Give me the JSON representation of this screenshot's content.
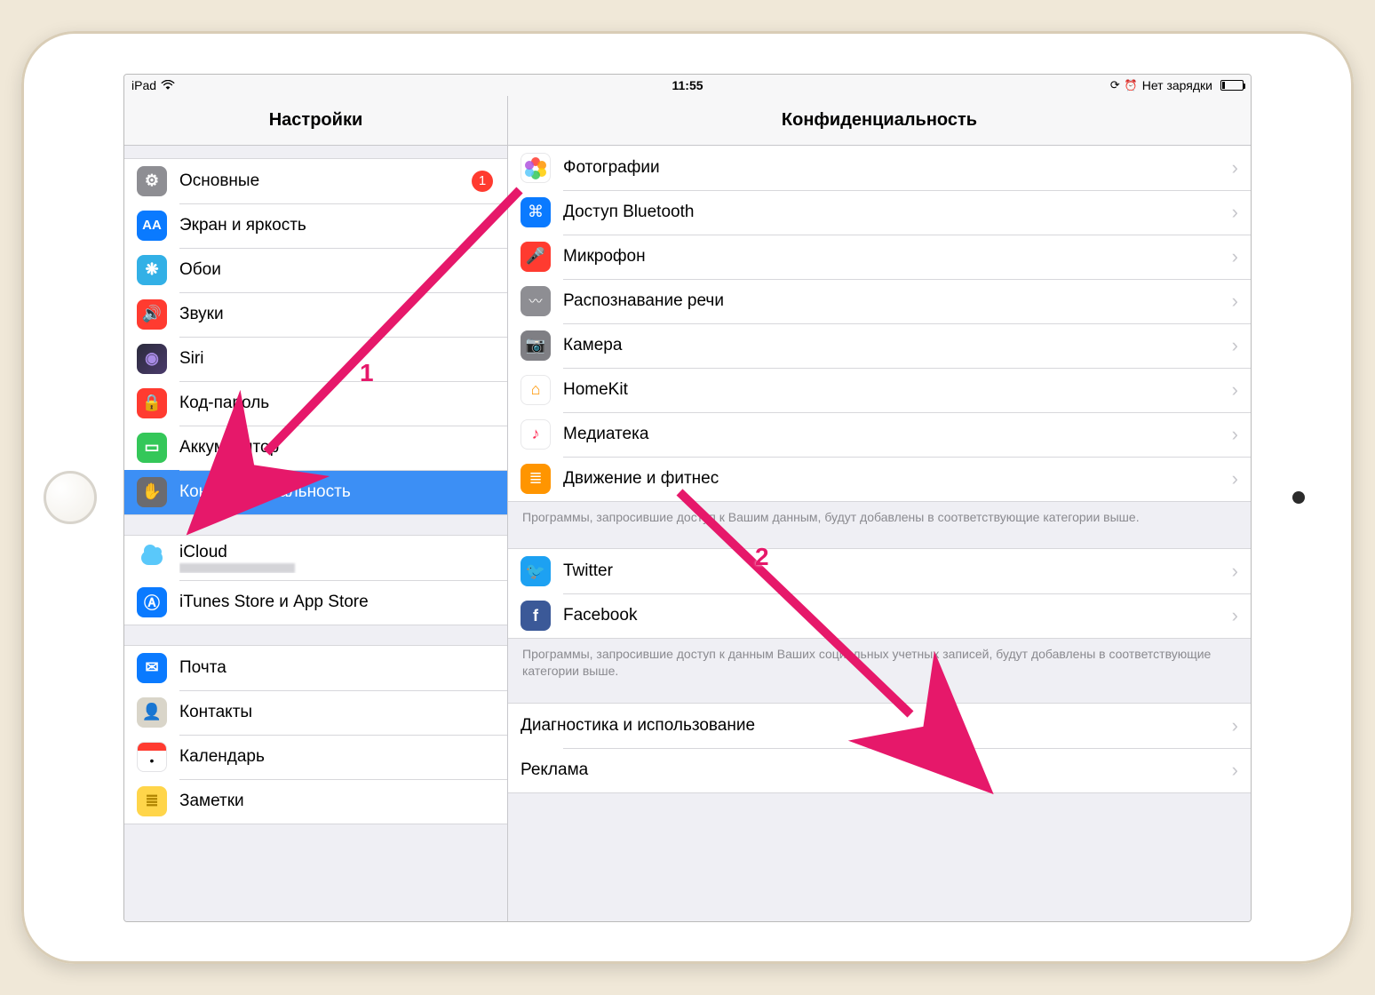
{
  "status": {
    "device": "iPad",
    "time": "11:55",
    "battery_text": "Нет зарядки"
  },
  "left": {
    "title": "Настройки",
    "group1": [
      {
        "key": "general",
        "label": "Основные",
        "icon": "gear",
        "badge": "1"
      },
      {
        "key": "display",
        "label": "Экран и яркость",
        "icon": "display"
      },
      {
        "key": "wallpaper",
        "label": "Обои",
        "icon": "wallpaper"
      },
      {
        "key": "sound",
        "label": "Звуки",
        "icon": "sound"
      },
      {
        "key": "siri",
        "label": "Siri",
        "icon": "siri"
      },
      {
        "key": "passcode",
        "label": "Код-пароль",
        "icon": "passcode"
      },
      {
        "key": "battery",
        "label": "Аккумулятор",
        "icon": "battery"
      },
      {
        "key": "privacy",
        "label": "Конфиденциальность",
        "icon": "privacy",
        "selected": true
      }
    ],
    "group2": [
      {
        "key": "icloud",
        "label": "iCloud",
        "icon": "icloud",
        "sub": ""
      },
      {
        "key": "appstore",
        "label": "iTunes Store и App Store",
        "icon": "appstore"
      }
    ],
    "group3": [
      {
        "key": "mail",
        "label": "Почта",
        "icon": "mail"
      },
      {
        "key": "contacts",
        "label": "Контакты",
        "icon": "contacts"
      },
      {
        "key": "calendar",
        "label": "Календарь",
        "icon": "calendar"
      },
      {
        "key": "notes",
        "label": "Заметки",
        "icon": "notes"
      }
    ]
  },
  "right": {
    "title": "Конфиденциальность",
    "group1": [
      {
        "key": "photos",
        "label": "Фотографии",
        "icon": "photos"
      },
      {
        "key": "bluetooth",
        "label": "Доступ Bluetooth",
        "icon": "bluetooth"
      },
      {
        "key": "mic",
        "label": "Микрофон",
        "icon": "mic"
      },
      {
        "key": "speech",
        "label": "Распознавание речи",
        "icon": "speech"
      },
      {
        "key": "camera",
        "label": "Камера",
        "icon": "camera"
      },
      {
        "key": "homekit",
        "label": "HomeKit",
        "icon": "homekit"
      },
      {
        "key": "media",
        "label": "Медиатека",
        "icon": "media"
      },
      {
        "key": "motion",
        "label": "Движение и фитнес",
        "icon": "motion"
      }
    ],
    "footer1": "Программы, запросившие доступ к Вашим данным, будут добавлены в соответствующие категории выше.",
    "group2": [
      {
        "key": "twitter",
        "label": "Twitter",
        "icon": "twitter"
      },
      {
        "key": "facebook",
        "label": "Facebook",
        "icon": "facebook"
      }
    ],
    "footer2": "Программы, запросившие доступ к данным Ваших социальных учетных записей, будут добавлены в соответствующие категории выше.",
    "group3": [
      {
        "key": "diag",
        "label": "Диагностика и использование"
      },
      {
        "key": "ads",
        "label": "Реклама"
      }
    ]
  },
  "annotations": {
    "label1": "1",
    "label2": "2"
  }
}
